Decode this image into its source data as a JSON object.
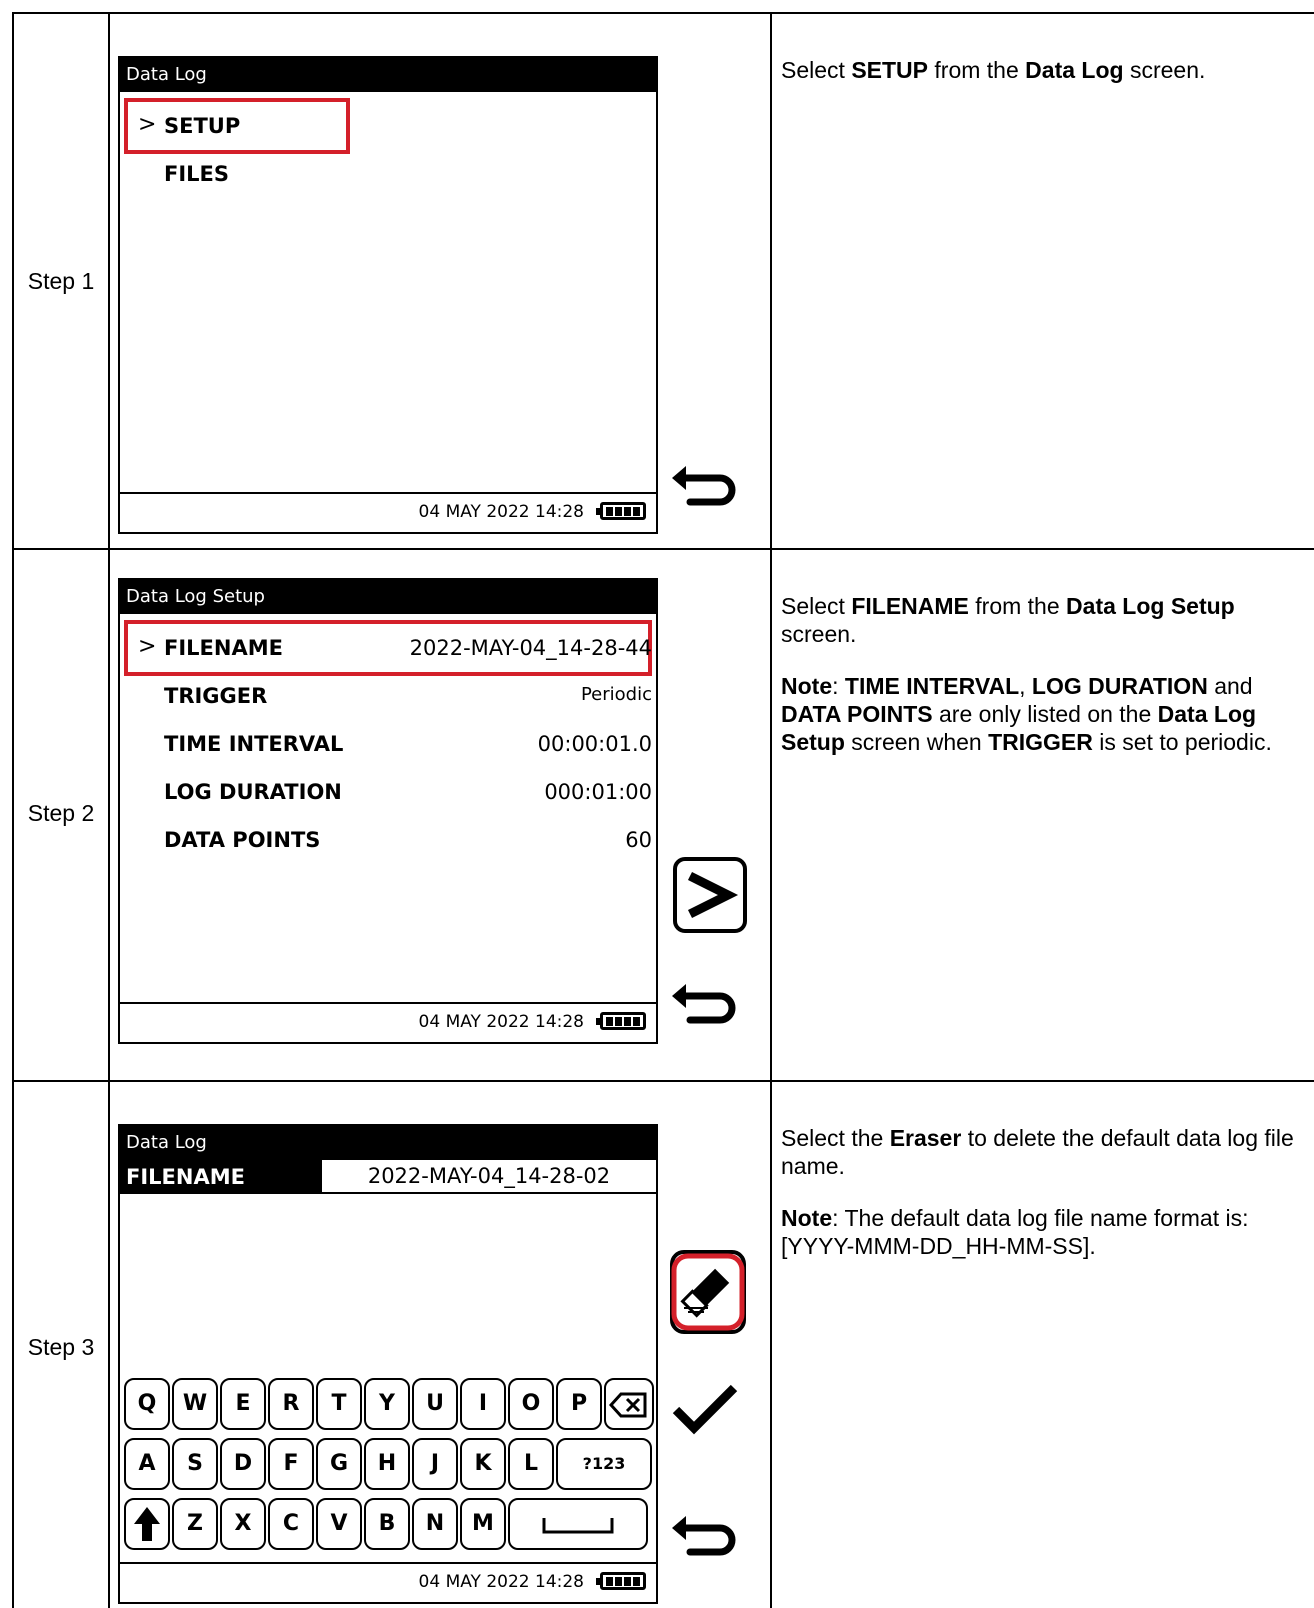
{
  "rows": [
    {
      "step_label": "Step 1",
      "screen": {
        "title": "Data Log",
        "items": [
          "SETUP",
          "FILES"
        ],
        "footer": "04 MAY 2022 14:28"
      },
      "icons": [
        "back-arrow-icon"
      ]
    },
    {
      "step_label": "Step 2",
      "screen": {
        "title": "Data Log Setup",
        "rows": [
          {
            "label": "FILENAME",
            "value": "2022-MAY-04_14-28-44"
          },
          {
            "label": "TRIGGER",
            "value": "Periodic"
          },
          {
            "label": "TIME INTERVAL",
            "value": "00:00:01.0"
          },
          {
            "label": "LOG DURATION",
            "value": "000:01:00"
          },
          {
            "label": "DATA POINTS",
            "value": "60"
          }
        ],
        "footer": "04 MAY 2022 14:28"
      },
      "icons": [
        "next-chevron-icon",
        "back-arrow-icon"
      ]
    },
    {
      "step_label": "Step 3",
      "screen": {
        "title": "Data Log",
        "field_label": "FILENAME",
        "field_value": "2022-MAY-04_14-28-02",
        "keyboard": {
          "row1": [
            "Q",
            "W",
            "E",
            "R",
            "T",
            "Y",
            "U",
            "I",
            "O",
            "P"
          ],
          "row2": [
            "A",
            "S",
            "D",
            "F",
            "G",
            "H",
            "J",
            "K",
            "L"
          ],
          "row2_extra": "?123",
          "row3": [
            "Z",
            "X",
            "C",
            "V",
            "B",
            "N",
            "M"
          ]
        },
        "footer": "04 MAY 2022 14:28"
      },
      "icons": [
        "eraser-icon",
        "check-icon",
        "back-arrow-icon"
      ]
    }
  ],
  "desc1": {
    "t1": "Select ",
    "b1": "SETUP",
    "t2": " from the ",
    "b2": "Data Log",
    "t3": " screen."
  },
  "desc2": {
    "t1": "Select ",
    "b1": "FILENAME",
    "t2": " from the ",
    "b2": "Data Log Setup",
    "t3": " screen.",
    "n_b": "Note",
    "n_t1": ": ",
    "n_b1": "TIME INTERVAL",
    "n_t2": ", ",
    "n_b2": "LOG DURATION",
    "n_t3": " and ",
    "n_b3": "DATA POINTS",
    "n_t4": " are only listed on the ",
    "n_b4": "Data Log Setup",
    "n_t5": " screen when ",
    "n_b5": "TRIGGER",
    "n_t6": " is set to periodic."
  },
  "desc3": {
    "t1": "Select the ",
    "b1": "Eraser",
    "t2": " to delete the default data log file name.",
    "n_b": "Note",
    "n_t": ": The default data log file name format is: [YYYY-MMM-DD_HH-MM-SS]."
  },
  "colors": {
    "highlight": "#d4202a",
    "ink": "#000000"
  }
}
